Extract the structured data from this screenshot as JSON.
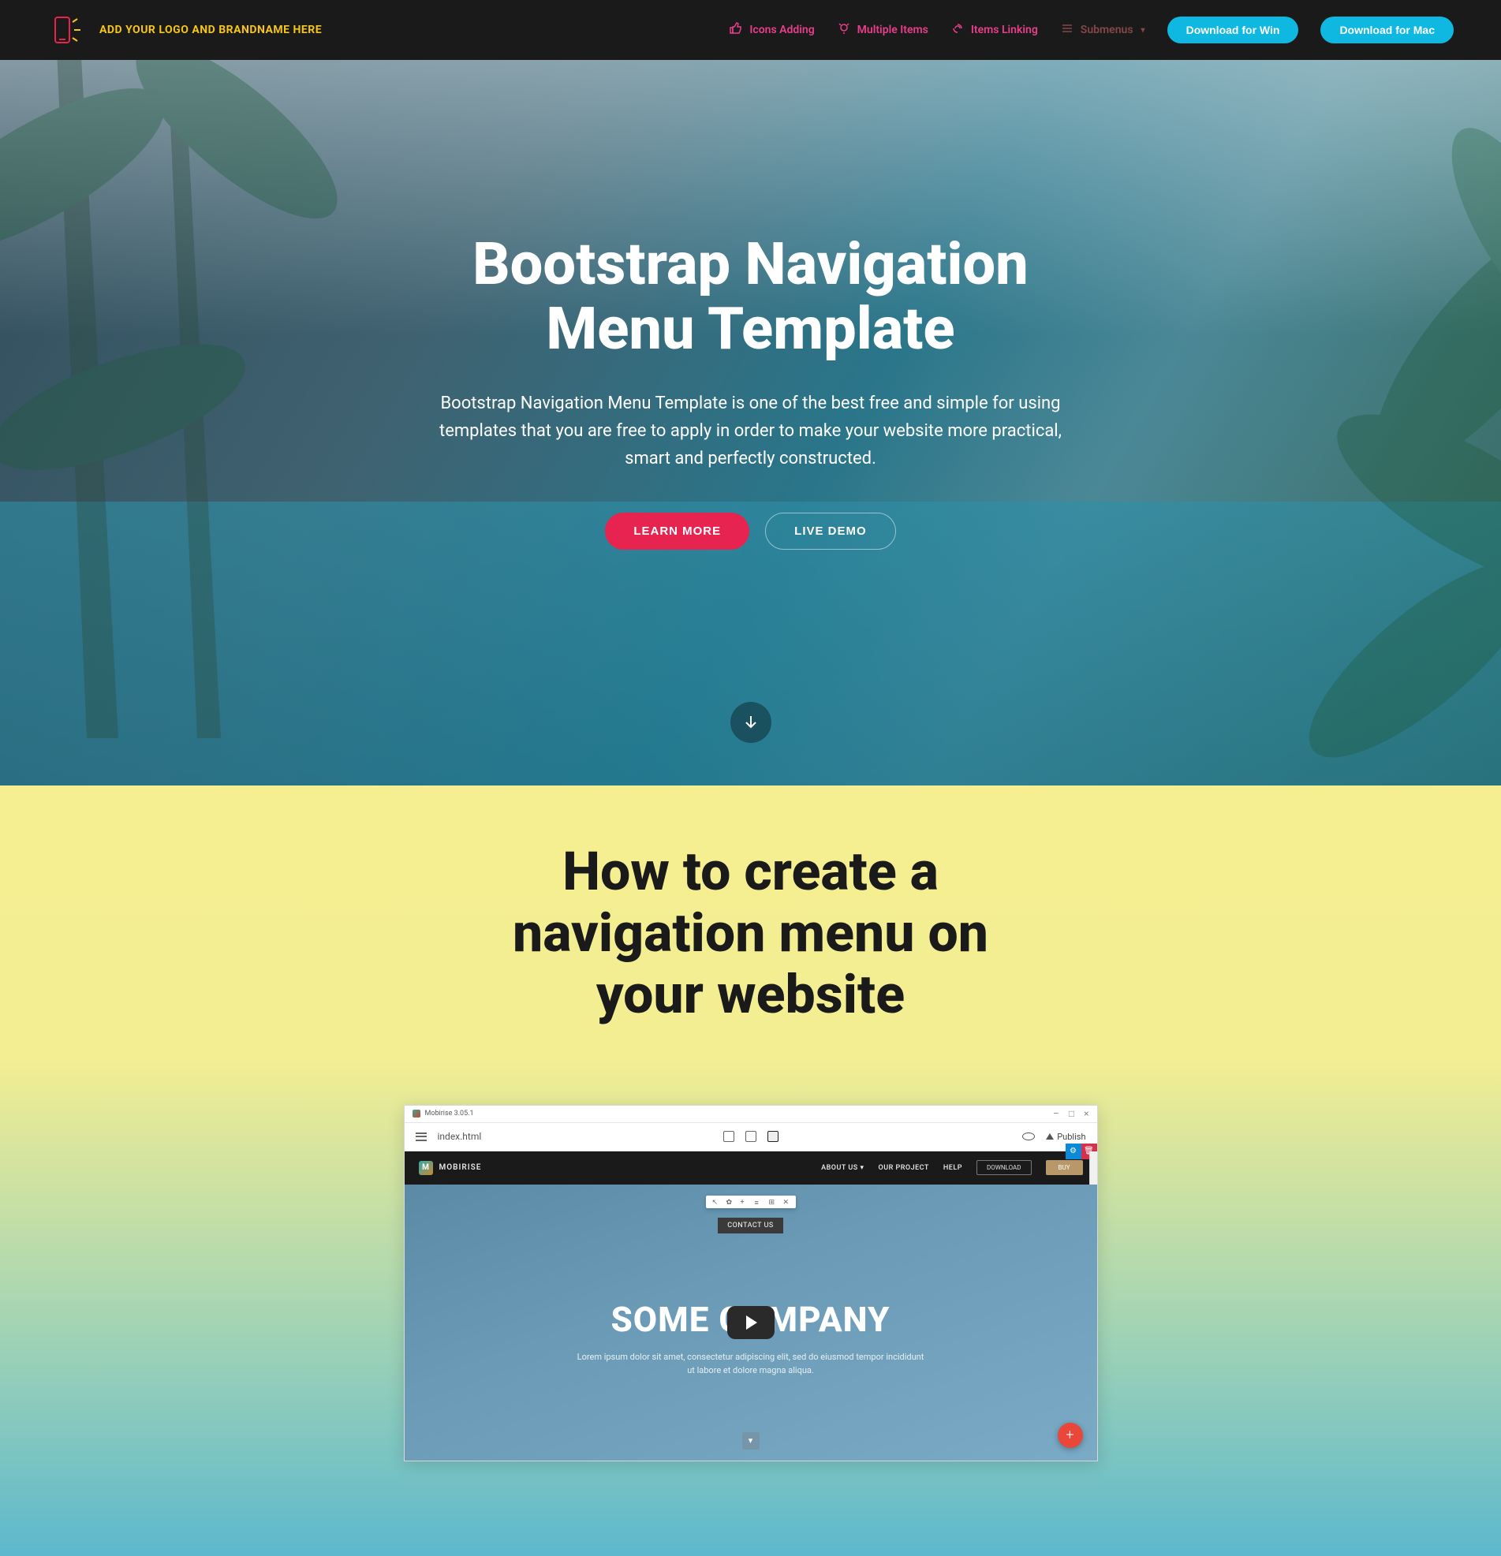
{
  "navbar": {
    "brand": "ADD YOUR LOGO AND BRANDNAME HERE",
    "links": {
      "icons_adding": "Icons Adding",
      "multiple_items": "Multiple Items",
      "items_linking": "Items Linking",
      "submenus": "Submenus"
    },
    "buttons": {
      "download_win": "Download for Win",
      "download_mac": "Download for Mac"
    }
  },
  "hero": {
    "title": "Bootstrap Navigation Menu Template",
    "description": "Bootstrap Navigation Menu Template is one of the best free and simple for using templates that you are free to apply in order to make your website more practical, smart and perfectly constructed.",
    "learn_more": "LEARN MORE",
    "live_demo": "LIVE DEMO"
  },
  "howto": {
    "title": "How to create a navigation menu on your website"
  },
  "video": {
    "app_version": "Mobirise 3.05.1",
    "file_name": "index.html",
    "publish": "Publish",
    "nav_brand": "MOBIRISE",
    "nav_links": {
      "about": "ABOUT US",
      "project": "OUR PROJECT",
      "help": "HELP"
    },
    "nav_download": "DOWNLOAD",
    "nav_buy": "BUY",
    "stage_label": "CONTACT US",
    "stage_title": "SOME COMPANY",
    "stage_sub": "Lorem ipsum dolor sit amet, consectetur adipiscing elit, sed do eiusmod tempor incididunt ut labore et dolore magna aliqua.",
    "fab": "+"
  },
  "colors": {
    "accent_pink": "#e6244f",
    "accent_cyan": "#0fb8e0",
    "nav_bg": "#1a1a1a",
    "brand_yellow": "#f5c518"
  }
}
